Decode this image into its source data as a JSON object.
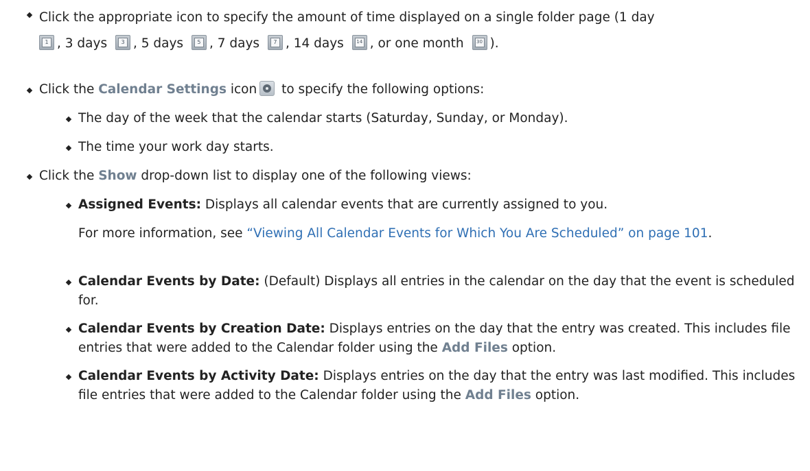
{
  "items": {
    "b1": {
      "prefix": "Click the appropriate icon to specify the amount of time displayed on a single folder page (1 day",
      "s1": ", 3 days",
      "s2": ", 5 days",
      "s3": ", 7 days",
      "s4": ", 14 days",
      "s5": ", or one month",
      "suffix": ").",
      "icon_labels": [
        "1",
        "3",
        "5",
        "7",
        "14",
        "30"
      ]
    },
    "b2": {
      "prefix": "Click the",
      "gui": "Calendar Settings",
      "middle": "icon",
      "suffix": "to specify the following options:"
    },
    "b2_1": "The day of the week that the calendar starts (Saturday, Sunday, or Monday).",
    "b2_2": "The time your work day starts.",
    "b3": {
      "prefix": "Click the",
      "gui": "Show",
      "suffix": "drop-down list to display one of the following views:"
    },
    "b3_1": {
      "term": "Assigned Events:",
      "desc": "Displays all calendar events that are currently assigned to you.",
      "more_prefix": "For more information, see",
      "link": "“Viewing All Calendar Events for Which You Are Scheduled” on page 101",
      "more_suffix": "."
    },
    "b3_2": {
      "term": "Calendar Events by Date:",
      "desc": "(Default) Displays all entries in the calendar on the day that the event is scheduled for."
    },
    "b3_3": {
      "term": "Calendar Events by Creation Date:",
      "desc": "Displays entries on the day that the entry was created. This includes file entries that were added to the Calendar folder using the",
      "gui": "Add Files",
      "suffix": "option."
    },
    "b3_4": {
      "term": "Calendar Events by Activity Date:",
      "desc": "Displays entries on the day that the entry was last modified. This includes file entries that were added to the Calendar folder using the",
      "gui": "Add Files",
      "suffix": "option."
    }
  }
}
